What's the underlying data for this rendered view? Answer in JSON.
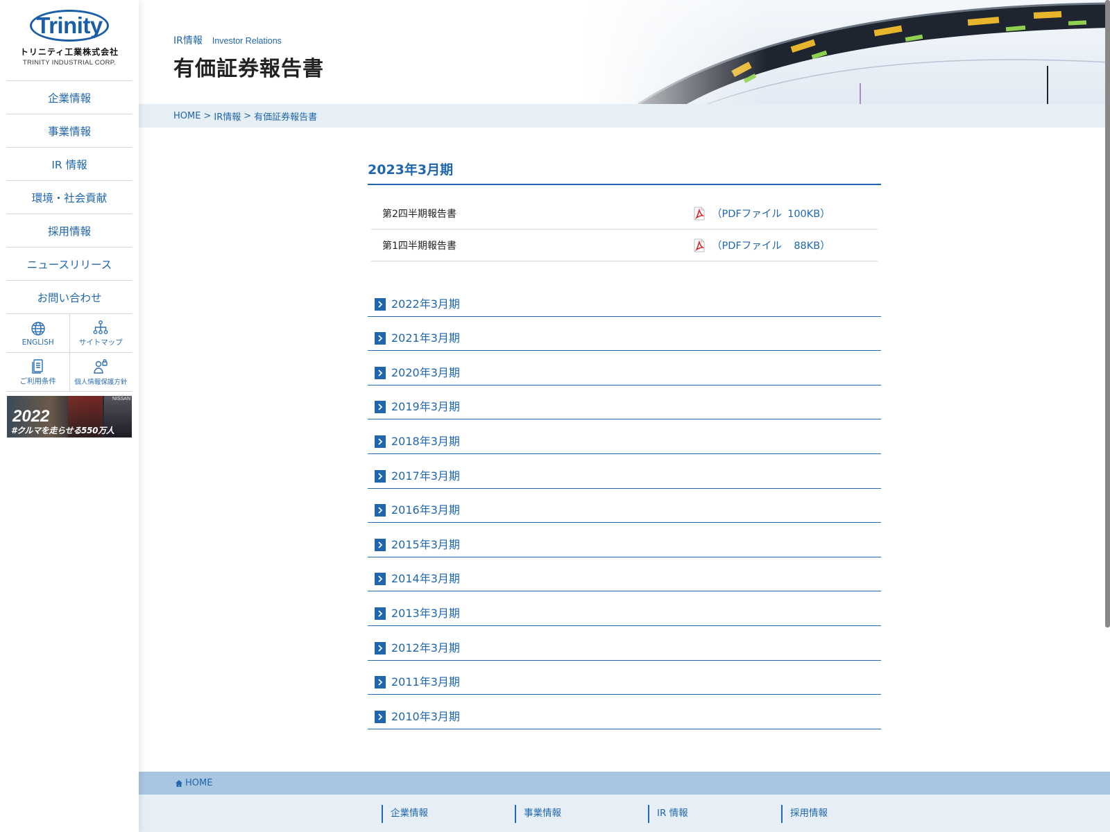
{
  "sidebar": {
    "logo_text": "Trinity",
    "logo_jp": "トリニティ工業株式会社",
    "logo_en": "TRINITY INDUSTRIAL CORP.",
    "nav": [
      "企業情報",
      "事業情報",
      "IR 情報",
      "環境・社会貢献",
      "採用情報",
      "ニュースリリース",
      "お問い合わせ"
    ],
    "utilities": {
      "english": "ENGLISH",
      "sitemap": "サイトマップ",
      "terms": "ご利用条件",
      "privacy": "個人情報保護方針"
    },
    "banner": {
      "year": "2022",
      "text": "#クルマを走らせる550万人",
      "brand": "NISSAN"
    }
  },
  "header": {
    "section_jp": "IR情報",
    "section_en": "Investor Relations",
    "title": "有価証券報告書"
  },
  "breadcrumb": {
    "home": "HOME",
    "sep1": ">",
    "ir": "IR情報",
    "sep2": ">",
    "current": "有価証券報告書"
  },
  "main": {
    "current_year": "2023年3月期",
    "reports": [
      {
        "name": "第2四半期報告書",
        "link_prefix": "（PDFファイル",
        "size": "100KB）"
      },
      {
        "name": "第1四半期報告書",
        "link_prefix": "（PDFファイル",
        "size": "88KB）"
      }
    ],
    "years": [
      "2022年3月期",
      "2021年3月期",
      "2020年3月期",
      "2019年3月期",
      "2018年3月期",
      "2017年3月期",
      "2016年3月期",
      "2015年3月期",
      "2014年3月期",
      "2013年3月期",
      "2012年3月期",
      "2011年3月期",
      "2010年3月期"
    ]
  },
  "footer": {
    "home": "HOME",
    "nav": [
      "企業情報",
      "事業情報",
      "IR 情報",
      "採用情報"
    ]
  },
  "colors": {
    "accent": "#1f66ad",
    "breadcrumb_bg": "#e6eef6",
    "footer_bar_bg": "#a8c5e2",
    "pdf_icon": "#d8262c"
  },
  "icons": {
    "english": "globe-icon",
    "sitemap": "sitemap-icon",
    "terms": "document-icon",
    "privacy": "person-lock-icon",
    "pdf": "pdf-icon",
    "year_arrow": "chevron-right-icon",
    "home": "home-icon"
  }
}
